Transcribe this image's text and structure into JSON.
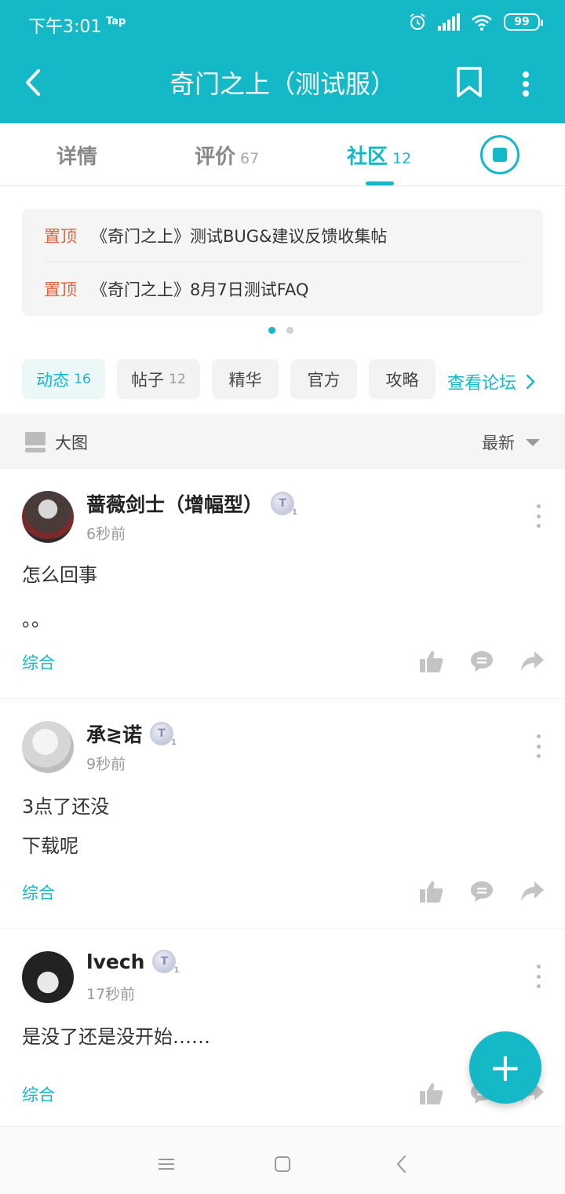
{
  "status_bar": {
    "time": "下午3:01",
    "carrier_tag": "Tap",
    "battery": "99"
  },
  "header": {
    "title": "奇门之上（测试服）"
  },
  "tabs": [
    {
      "label": "详情",
      "count": ""
    },
    {
      "label": "评价",
      "count": "67"
    },
    {
      "label": "社区",
      "count": "12",
      "active": true
    }
  ],
  "pinned": [
    {
      "tag": "置顶",
      "title": "《奇门之上》测试BUG&建议反馈收集帖"
    },
    {
      "tag": "置顶",
      "title": "《奇门之上》8月7日测试FAQ"
    }
  ],
  "chips": [
    {
      "label": "动态",
      "count": "16",
      "active": true
    },
    {
      "label": "帖子",
      "count": "12"
    },
    {
      "label": "精华",
      "count": ""
    },
    {
      "label": "官方",
      "count": ""
    },
    {
      "label": "攻略",
      "count": ""
    }
  ],
  "forum_link": "查看论坛",
  "filter": {
    "view_label": "大图",
    "sort_label": "最新"
  },
  "posts": [
    {
      "username": "蔷薇剑士（增幅型）",
      "badge": "T",
      "badge_level": "1",
      "time": "6秒前",
      "lines": [
        "怎么回事",
        "。。"
      ],
      "category": "综合"
    },
    {
      "username": "承≷诺",
      "badge": "T",
      "badge_level": "1",
      "time": "9秒前",
      "lines": [
        "3点了还没",
        "下载呢"
      ],
      "category": "综合"
    },
    {
      "username": "lvech",
      "badge": "T",
      "badge_level": "1",
      "time": "17秒前",
      "lines": [
        "是没了还是没开始……"
      ],
      "category": "综合"
    }
  ],
  "fab_label": "+",
  "colors": {
    "brand": "#15b8c7",
    "pin_tag": "#e6633c"
  }
}
